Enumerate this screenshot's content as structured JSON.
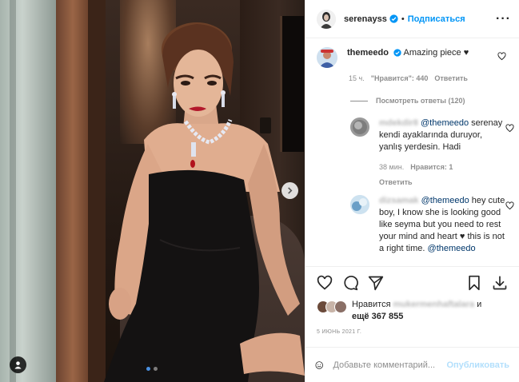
{
  "post": {
    "author": "serenayss",
    "follow_separator": "•",
    "follow_label": "Подписаться",
    "more_label": "···"
  },
  "comment": {
    "author": "themeedo",
    "text": "Amazing piece",
    "heart_glyph": "♥",
    "time": "15 ч.",
    "likes": "\"Нравится\": 440",
    "reply_label": "Ответить",
    "view_replies": "Посмотреть ответы (120)"
  },
  "replies": [
    {
      "author": "mdekdir8",
      "mention": "@themeedo",
      "text": "serenay kendi ayaklarında duruyor, yanlış yerdesin. Hadi",
      "time": "38 мин.",
      "likes": "Нравится: 1",
      "reply_label": "Ответить"
    },
    {
      "author": "dizsamak",
      "mention": "@themeedo",
      "text": "hey cute boy, I know she is looking good like seyma but you need to rest your mind and heart ♥ this is not a right time.",
      "tail_mention": "@themeedo"
    }
  ],
  "likes_summary": {
    "prefix": "Нравится",
    "blurred_user": "mukermenhaftalara",
    "suffix": "и",
    "more": "ещё 367 855"
  },
  "date": "5 ИЮНЬ 2021 Г.",
  "composer": {
    "placeholder": "Добавьте комментарий...",
    "publish_label": "Опубликовать"
  },
  "carousel": {
    "slide_count": 2,
    "active_slide": 1
  },
  "icons": [
    "verified-badge-icon",
    "heart-icon",
    "comment-icon",
    "share-icon",
    "bookmark-icon",
    "download-icon",
    "emoji-icon",
    "next-arrow-icon",
    "user-tag-icon"
  ],
  "colors": {
    "accent": "#0095f6",
    "publish_disabled": "#b2dffc",
    "muted": "#8e8e8e",
    "text": "#262626"
  }
}
